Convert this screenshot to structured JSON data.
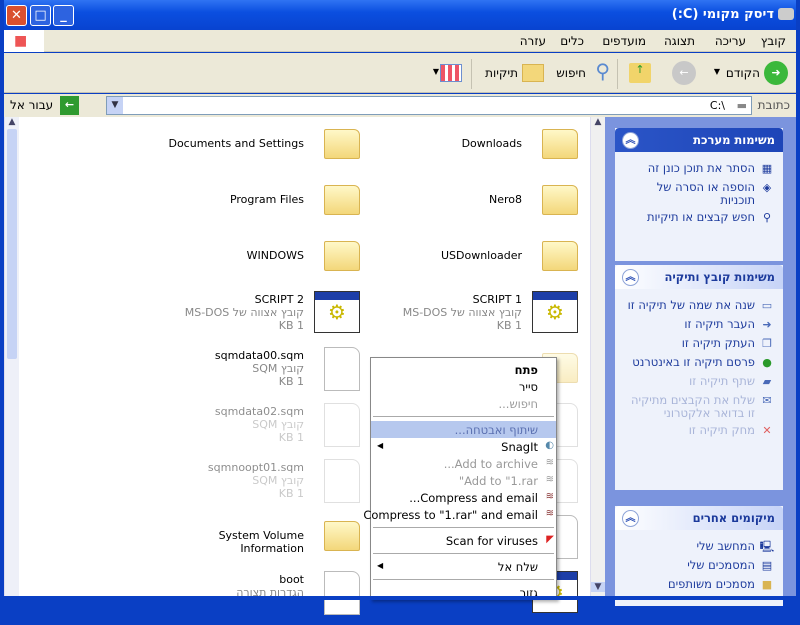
{
  "window": {
    "title": "דיסק מקומי (C:)"
  },
  "menu": [
    "קובץ",
    "עריכה",
    "תצוגה",
    "מועדפים",
    "כלים",
    "עזרה"
  ],
  "toolbar": {
    "back": "הקודם",
    "search": "חיפוש",
    "folders": "תיקיות"
  },
  "address": {
    "label": "כתובת",
    "value": "C:\\",
    "go": "עבור אל"
  },
  "files": [
    {
      "name": "Downloads",
      "type": "folder"
    },
    {
      "name": "Documents and Settings",
      "type": "folder"
    },
    {
      "name": "Nero8",
      "type": "folder"
    },
    {
      "name": "Program Files",
      "type": "folder"
    },
    {
      "name": "USDownloader",
      "type": "folder"
    },
    {
      "name": "WINDOWS",
      "type": "folder"
    },
    {
      "name": "SCRIPT 1",
      "type": "dos",
      "desc": "קובץ אצווה של MS-DOS",
      "size": "1 KB"
    },
    {
      "name": "SCRIPT 2",
      "type": "dos",
      "desc": "קובץ אצווה של MS-DOS",
      "size": "1 KB"
    },
    {
      "name": "",
      "type": "folder-dim"
    },
    {
      "name": "sqmdata00.sqm",
      "type": "doc",
      "desc": "קובץ SQM",
      "size": "1 KB"
    },
    {
      "name": "",
      "type": "doc-dim"
    },
    {
      "name": "sqmdata02.sqm",
      "type": "doc",
      "desc": "קובץ SQM",
      "size": "1 KB",
      "dim": true
    },
    {
      "name": "",
      "type": "doc-dim"
    },
    {
      "name": "sqmnoopt01.sqm",
      "type": "doc",
      "desc": "קובץ SQM",
      "size": "1 KB",
      "dim": true
    },
    {
      "name": "",
      "type": "doc"
    },
    {
      "name": "System Volume Information",
      "type": "folder"
    },
    {
      "name": "",
      "type": "dos"
    },
    {
      "name": "boot",
      "type": "doc",
      "desc": "הגדרות תצורה"
    }
  ],
  "taskpane": {
    "system": {
      "title": "משימות מערכת",
      "items": [
        "הסתר את תוכן כונן זה",
        "הוספה או הסרה של תוכניות",
        "חפש קבצים או תיקיות"
      ]
    },
    "filefolder": {
      "title": "משימות קובץ ותיקיה",
      "items": [
        "שנה את שמה של תיקיה זו",
        "העבר תיקיה זו",
        "העתק תיקיה זו",
        "פרסם תיקיה זו באינטרנט",
        "שתף תיקיה זו",
        "שלח את הקבצים מתיקיה זו בדואר אלקטרוני",
        "מחק תיקיה זו"
      ]
    },
    "places": {
      "title": "מיקומים אחרים",
      "items": [
        "המחשב שלי",
        "המסמכים שלי",
        "מסמכים משותפים"
      ]
    }
  },
  "context_menu": [
    "פתח",
    "סייר",
    "חיפוש...",
    "שיתוף ואבטחה...",
    "SnagIt",
    "Add to archive...",
    "Add to \"1.rar\"",
    "Compress and email...",
    "Compress to \"1.rar\" and email",
    "Scan for viruses",
    "שלח אל",
    "גזור"
  ]
}
